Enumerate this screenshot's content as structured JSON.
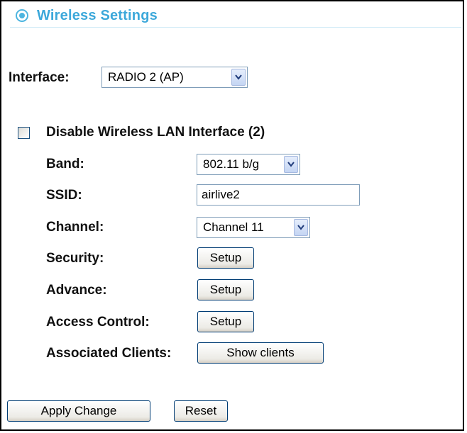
{
  "header": {
    "title": "Wireless Settings",
    "icon": "radio-target-icon",
    "accent_color": "#3ca8da"
  },
  "interface": {
    "label": "Interface:",
    "selected": "RADIO 2 (AP)"
  },
  "disable_wlan": {
    "label": "Disable Wireless LAN Interface (2)",
    "checked": false
  },
  "band": {
    "label": "Band:",
    "selected": "802.11 b/g"
  },
  "ssid": {
    "label": "SSID:",
    "value": "airlive2"
  },
  "channel": {
    "label": "Channel:",
    "selected": "Channel 11"
  },
  "security": {
    "label": "Security:",
    "button": "Setup"
  },
  "advance": {
    "label": "Advance:",
    "button": "Setup"
  },
  "access_control": {
    "label": "Access Control:",
    "button": "Setup"
  },
  "associated_clients": {
    "label": "Associated Clients:",
    "button": "Show clients"
  },
  "footer": {
    "apply_label": "Apply Change",
    "reset_label": "Reset"
  }
}
